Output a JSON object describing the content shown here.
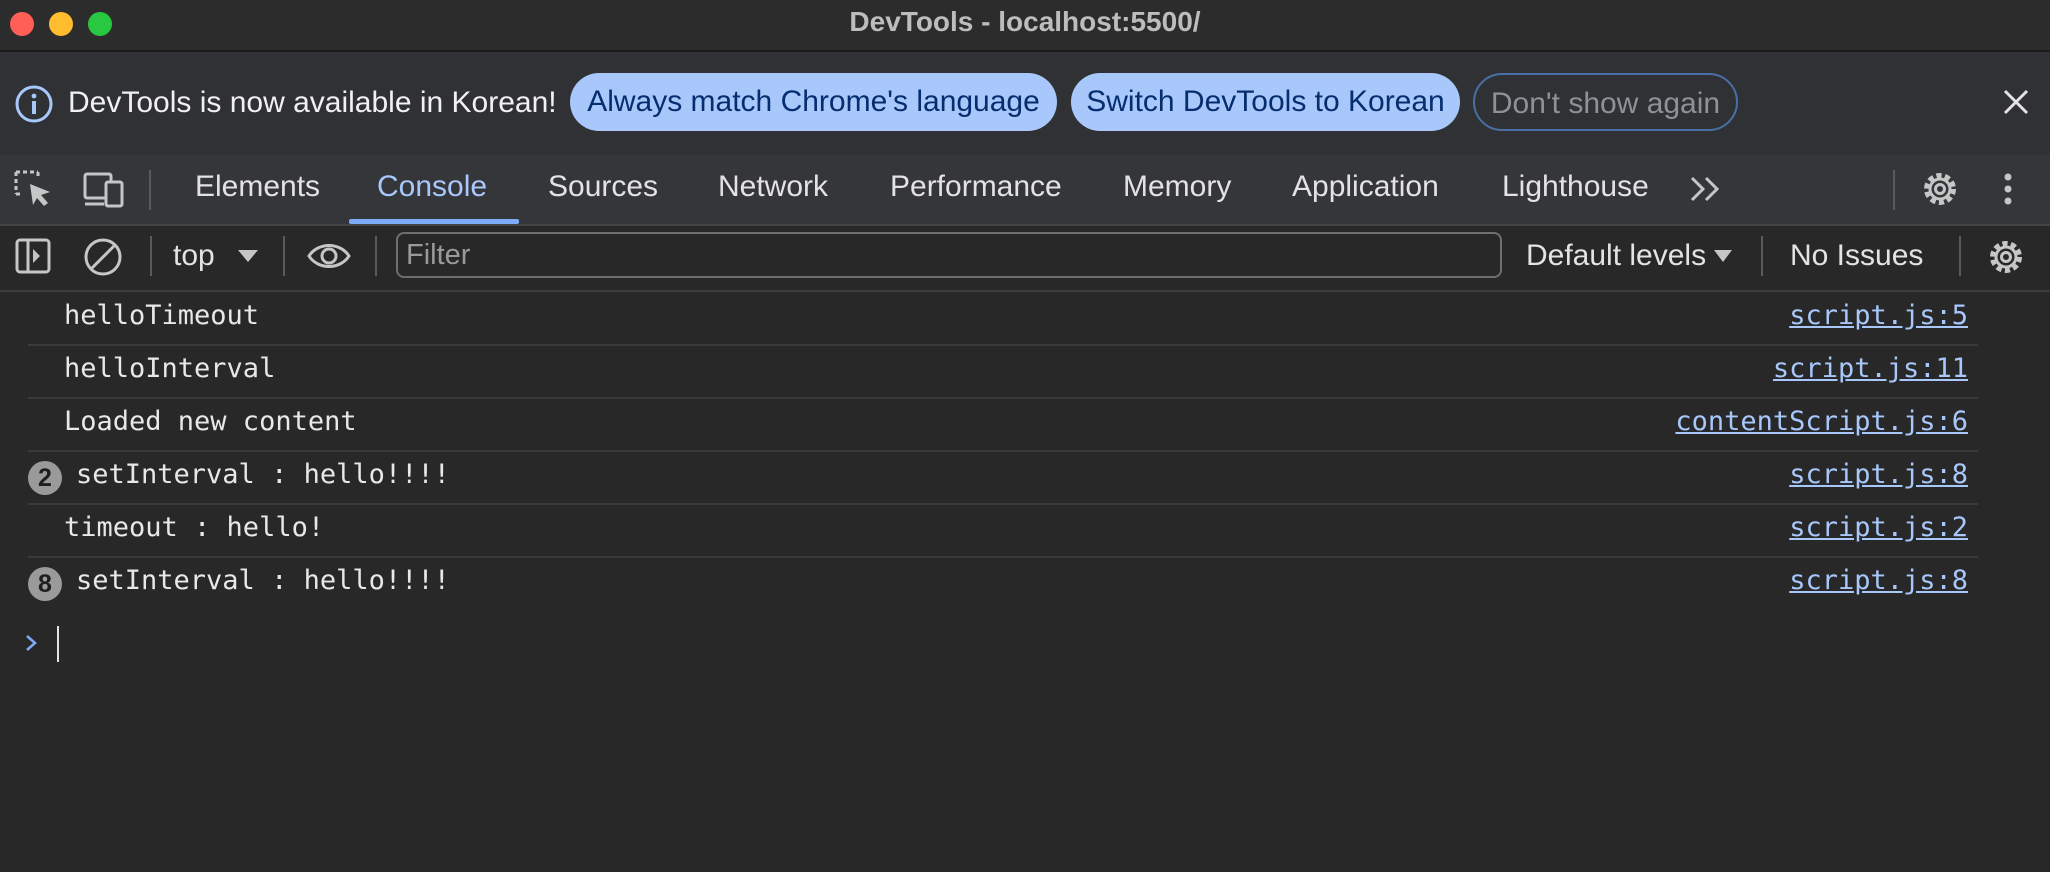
{
  "window": {
    "title": "DevTools - localhost:5500/"
  },
  "infobar": {
    "message": "DevTools is now available in Korean!",
    "buttons": {
      "match_language": "Always match Chrome's language",
      "switch_language": "Switch DevTools to Korean",
      "dont_show": "Don't show again"
    }
  },
  "tabs": [
    "Elements",
    "Console",
    "Sources",
    "Network",
    "Performance",
    "Memory",
    "Application",
    "Lighthouse"
  ],
  "active_tab": "Console",
  "console_toolbar": {
    "context": "top",
    "filter_placeholder": "Filter",
    "levels": "Default levels",
    "issues": "No Issues"
  },
  "messages": [
    {
      "text": "helloTimeout",
      "source": "script.js:5",
      "count": ""
    },
    {
      "text": "helloInterval",
      "source": "script.js:11",
      "count": ""
    },
    {
      "text": "Loaded new content",
      "source": "contentScript.js:6",
      "count": ""
    },
    {
      "text": "setInterval : hello!!!!",
      "source": "script.js:8",
      "count": "2"
    },
    {
      "text": "timeout : hello!",
      "source": "script.js:2",
      "count": ""
    },
    {
      "text": "setInterval : hello!!!!",
      "source": "script.js:8",
      "count": "8"
    }
  ],
  "colors": {
    "accent": "#a8c7fa",
    "background": "#282828"
  }
}
